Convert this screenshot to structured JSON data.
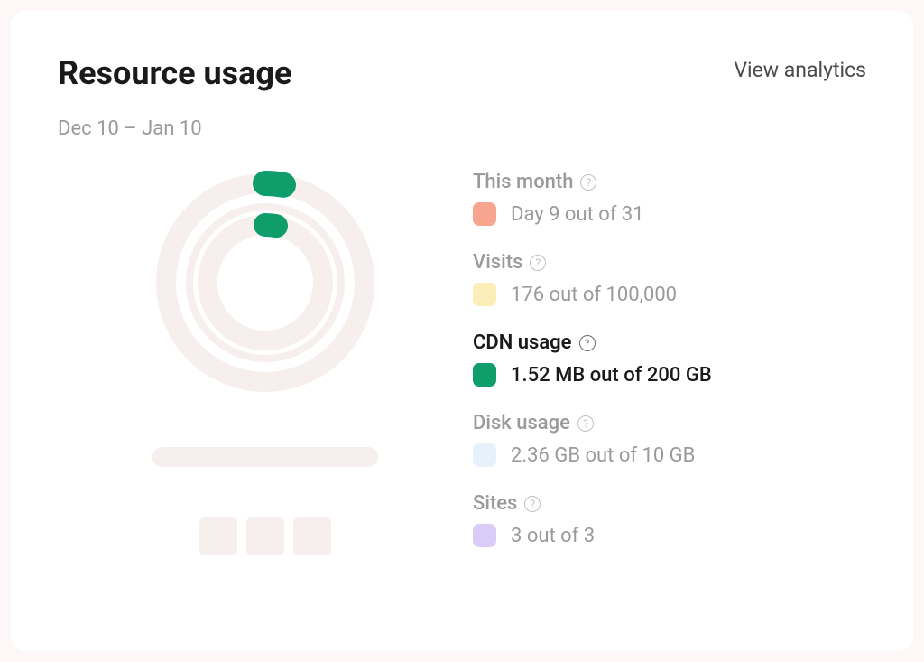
{
  "header": {
    "title": "Resource usage",
    "view_analytics": "View analytics",
    "date_range": "Dec 10 – Jan 10"
  },
  "legend": [
    {
      "title": "This month",
      "value": "Day 9 out of 31",
      "color": "#f7a58e",
      "active": false
    },
    {
      "title": "Visits",
      "value": "176 out of 100,000",
      "color": "#fbeeb6",
      "active": false
    },
    {
      "title": "CDN usage",
      "value": "1.52 MB out of 200 GB",
      "color": "#0f9d6c",
      "active": true
    },
    {
      "title": "Disk usage",
      "value": "2.36 GB out of 10 GB",
      "color": "#e7f1fb",
      "active": false
    },
    {
      "title": "Sites",
      "value": "3 out of 3",
      "color": "#d9ccf7",
      "active": false
    }
  ],
  "chart_data": {
    "type": "pie",
    "title": "Resource usage",
    "series": [
      {
        "name": "This month",
        "value": 9,
        "max": 31,
        "color": "#f7a58e"
      },
      {
        "name": "Visits",
        "value": 176,
        "max": 100000,
        "color": "#fbeeb6"
      },
      {
        "name": "CDN usage",
        "value": 1.52,
        "max": 200000,
        "unit_value": "MB",
        "unit_max": "GB",
        "color": "#0f9d6c"
      },
      {
        "name": "Disk usage",
        "value": 2.36,
        "max": 10,
        "unit": "GB",
        "color": "#e7f1fb"
      },
      {
        "name": "Sites",
        "value": 3,
        "max": 3,
        "color": "#d9ccf7"
      }
    ]
  }
}
